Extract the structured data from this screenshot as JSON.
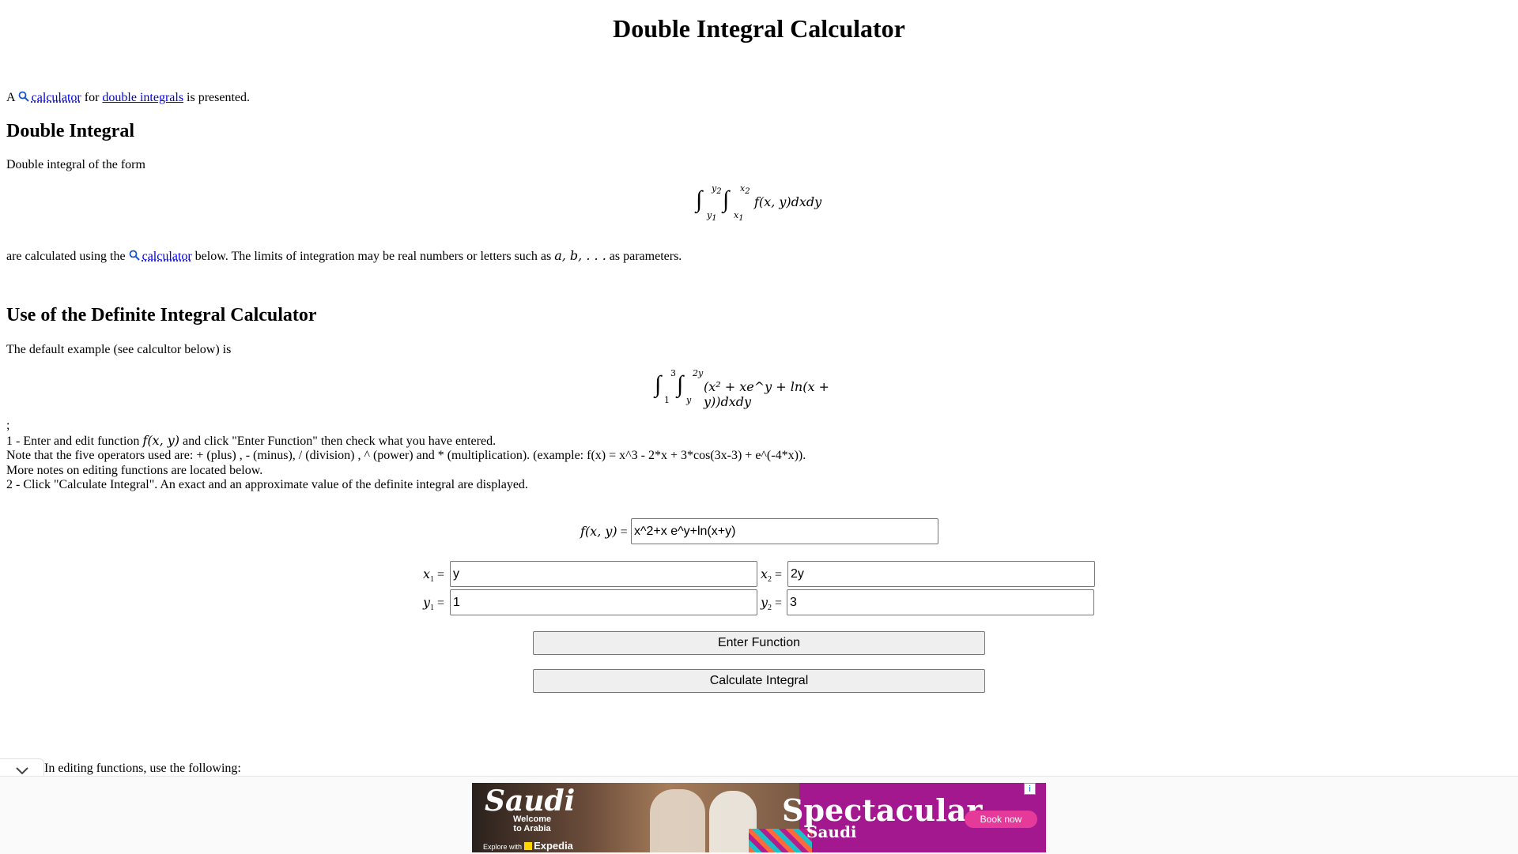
{
  "page": {
    "title": "Double Integral Calculator"
  },
  "intro": {
    "prefix": "A",
    "calc_link": "calculator",
    "for": "for",
    "double_link": "double integrals",
    "suffix": "is presented."
  },
  "section1": {
    "heading": "Double Integral",
    "form_text": "Double integral of the form",
    "formula": {
      "upper_y": "y",
      "upper_y_sub": "2",
      "lower_y": "y",
      "lower_y_sub": "1",
      "upper_x": "x",
      "upper_x_sub": "2",
      "lower_x": "x",
      "lower_x_sub": "1",
      "integrand": "f(x, y)dxdy"
    },
    "calc_prefix": "are calculated using the",
    "calc_link": "calculator",
    "calc_suffix": "below. The limits of integration may be real numbers or letters such as",
    "params": "a, b, . . .",
    "params_suffix": "as parameters."
  },
  "section2": {
    "heading": "Use of the Definite Integral Calculator",
    "default_text": "The default example (see calcultor below) is",
    "example": {
      "upper_y": "3",
      "lower_y": "1",
      "upper_x": "2y",
      "lower_x": "y",
      "integrand": "(x² + xe^y + ln(x + y))dxdy"
    },
    "semicolon": ";",
    "step1_prefix": "1 - Enter and edit function",
    "step1_fn": "f(x, y)",
    "step1_suffix": "and click \"Enter Function\" then check what you have entered.",
    "note": "Note that the five operators used are: + (plus) , - (minus), / (division) , ^ (power) and * (multiplication). (example: f(x) = x^3 - 2*x + 3*cos(3x-3) + e^(-4*x)).",
    "more_notes": "More notes on editing functions are located below.",
    "step2": "2 - Click \"Calculate Integral\". An exact and an approximate value of the definite integral are displayed."
  },
  "calculator": {
    "fxy_label": "f(x, y)",
    "fxy_value": "x^2+x e^y+ln(x+y)",
    "x1_label": "x",
    "x1_sub": "1",
    "x1_value": "y",
    "x2_label": "x",
    "x2_sub": "2",
    "x2_value": "2y",
    "y1_label": "y",
    "y1_sub": "1",
    "y1_value": "1",
    "y2_label": "y",
    "y2_sub": "2",
    "y2_value": "3",
    "equals": "=",
    "enter_button": "Enter Function",
    "calculate_button": "Calculate Integral"
  },
  "editing": {
    "text": "In editing functions, use the following:"
  },
  "ad": {
    "brand": "Saudi",
    "welcome": "Welcome",
    "to_arabia": "to Arabia",
    "explore": "Explore with",
    "expedia": "Expedia",
    "headline": "Spectacular",
    "sub": "Saudi",
    "cta": "Book now",
    "info": "i"
  }
}
